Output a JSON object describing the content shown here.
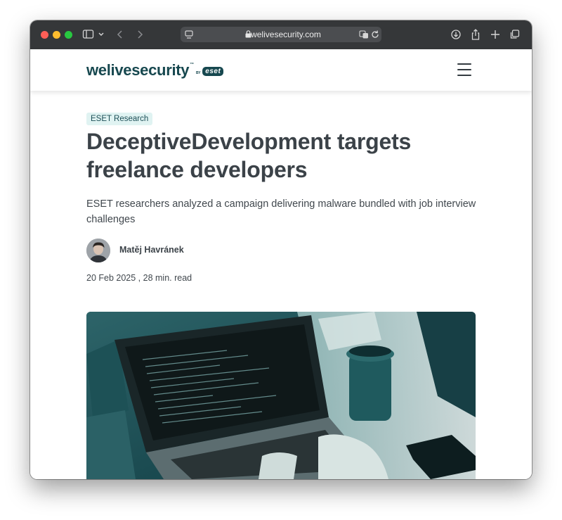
{
  "browser": {
    "url": "welivesecurity.com",
    "icons": [
      "sidebar-icon",
      "chevron-down-icon",
      "back-icon",
      "forward-icon",
      "page-menu-icon",
      "lock-icon",
      "translate-icon",
      "reload-icon",
      "download-icon",
      "share-icon",
      "new-tab-icon",
      "tab-overview-icon"
    ]
  },
  "site": {
    "logo_text": "welivesecurity",
    "logo_tm": "™",
    "logo_by": "BY",
    "logo_eset": "eset"
  },
  "article": {
    "category": "ESET Research",
    "title": "DeceptiveDevelopment targets freelance developers",
    "subtitle": "ESET researchers analyzed a campaign delivering malware bundled with job interview challenges",
    "author": "Matěj Havránek",
    "date": "20 Feb 2025",
    "separator": " , ",
    "read_time": "28 min. read"
  },
  "colors": {
    "brand": "#17484f",
    "tag_bg": "#e0f3f2",
    "text": "#3b4248",
    "toolbar": "#353739"
  }
}
